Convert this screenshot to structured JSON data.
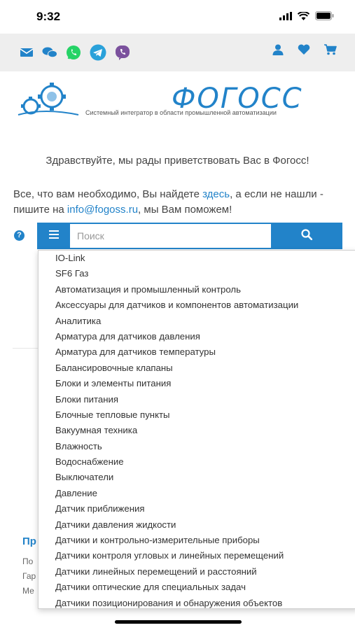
{
  "status": {
    "time": "9:32"
  },
  "topbar": {
    "left_icons": [
      "mail-icon",
      "chat-icon",
      "whatsapp-icon",
      "telegram-icon",
      "viber-icon"
    ],
    "right_icons": [
      "user-icon",
      "heart-icon",
      "cart-icon"
    ],
    "accent": "#2283c9"
  },
  "brand": {
    "name": "ФОГОСС",
    "tagline": "Системный интегратор в области промышленной автоматизации"
  },
  "greeting": "Здравствуйте, мы рады приветствовать Вас в Фогосс!",
  "info": {
    "part1": "Все, что вам необходимо, Вы найдете ",
    "link1": "здесь",
    "part2": ", а если не нашли - пишите на ",
    "email": "info@fogoss.ru",
    "part3": ", мы Вам поможем!"
  },
  "search": {
    "placeholder": "Поиск"
  },
  "background_section": {
    "title": "Пр",
    "lines": [
      "По",
      "Гар",
      "Ме"
    ]
  },
  "categories": [
    "IO-Link",
    "SF6 Газ",
    "Автоматизация и промышленный контроль",
    "Аксессуары для датчиков и компонентов автоматизации",
    "Аналитика",
    "Арматура для датчиков давления",
    "Арматура для датчиков температуры",
    "Балансировочные клапаны",
    "Блоки и элементы питания",
    "Блоки питания",
    "Блочные тепловые пункты",
    "Вакуумная техника",
    "Влажность",
    "Водоснабжение",
    "Выключатели",
    "Давление",
    "Датчик приближения",
    "Датчики давления жидкости",
    "Датчики и контрольно-измерительные приборы",
    "Датчики контроля угловых и линейных перемещений",
    "Датчики линейных перемещений и расстояний",
    "Датчики оптические для специальных задач",
    "Датчики позиционирования и обнаружения объектов"
  ]
}
